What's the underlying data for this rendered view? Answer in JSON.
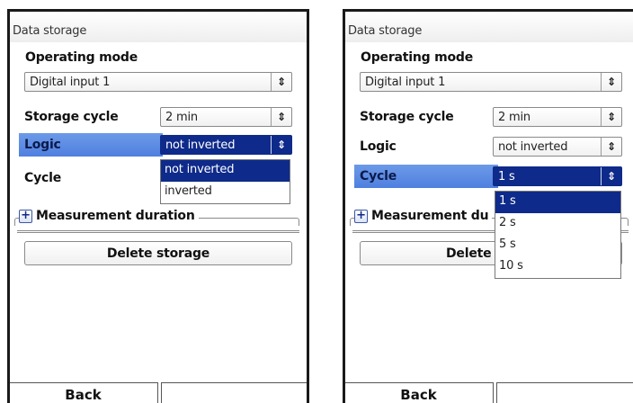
{
  "screens": [
    {
      "title": "Data storage",
      "operating_mode": {
        "label": "Operating mode",
        "value": "Digital input 1"
      },
      "storage_cycle": {
        "label": "Storage cycle",
        "value": "2 min"
      },
      "logic": {
        "label": "Logic",
        "value": "not inverted"
      },
      "cycle": {
        "label": "Cycle"
      },
      "dropdown": {
        "options": [
          "not inverted",
          "inverted"
        ],
        "selected": "not inverted"
      },
      "measurement_duration": "Measurement duration",
      "delete_storage": "Delete storage",
      "softkeys": {
        "left": "Back",
        "right": ""
      }
    },
    {
      "title": "Data storage",
      "operating_mode": {
        "label": "Operating mode",
        "value": "Digital input 1"
      },
      "storage_cycle": {
        "label": "Storage cycle",
        "value": "2 min"
      },
      "logic": {
        "label": "Logic",
        "value": "not inverted"
      },
      "cycle": {
        "label": "Cycle",
        "value": "1 s"
      },
      "dropdown": {
        "options": [
          "1 s",
          "2 s",
          "5 s",
          "10 s"
        ],
        "selected": "1 s"
      },
      "measurement_duration": "Measurement du",
      "delete_storage": "Delete s",
      "softkeys": {
        "left": "Back",
        "right": ""
      }
    }
  ],
  "icons": {
    "spin": "up-down-arrows-icon",
    "expand": "plus-icon"
  },
  "colors": {
    "highlight_row": "#4f80df",
    "selected": "#0e2a8a"
  }
}
